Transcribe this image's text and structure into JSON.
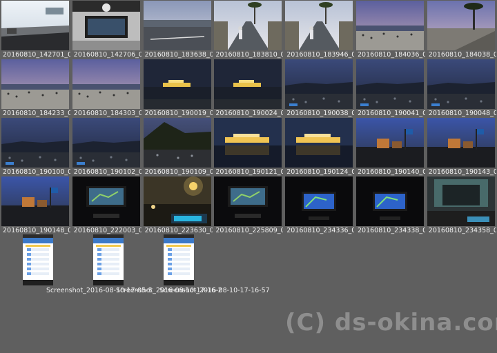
{
  "thumbnails": [
    {
      "label": "20160810_142701_0",
      "scene": "car-dash-day"
    },
    {
      "label": "20160810_142706_0",
      "scene": "car-console"
    },
    {
      "label": "20160810_183638_0",
      "scene": "road-dusk"
    },
    {
      "label": "20160810_183810_0",
      "scene": "street-palms"
    },
    {
      "label": "20160810_183946_0",
      "scene": "street-palms"
    },
    {
      "label": "20160810_184036_0",
      "scene": "beach-crowd-dusk"
    },
    {
      "label": "20160810_184038_0",
      "scene": "beach-palms-dusk"
    },
    {
      "label": "20160810_184233_0",
      "scene": "beach-crowd-dusk"
    },
    {
      "label": "20160810_184303_0",
      "scene": "beach-crowd-dusk"
    },
    {
      "label": "20160810_190019_0",
      "scene": "ship-night"
    },
    {
      "label": "20160810_190024_0",
      "scene": "ship-night"
    },
    {
      "label": "20160810_190038_0",
      "scene": "beach-night"
    },
    {
      "label": "20160810_190041_0",
      "scene": "beach-night"
    },
    {
      "label": "20160810_190048_0",
      "scene": "beach-night"
    },
    {
      "label": "20160810_190100_0",
      "scene": "beach-night"
    },
    {
      "label": "20160810_190102_0",
      "scene": "beach-night"
    },
    {
      "label": "20160810_190109_0",
      "scene": "hill-crowd-night"
    },
    {
      "label": "20160810_190121_0",
      "scene": "ship-night-lit"
    },
    {
      "label": "20160810_190124_0",
      "scene": "ship-night-lit"
    },
    {
      "label": "20160810_190140_0",
      "scene": "town-night-sign"
    },
    {
      "label": "20160810_190143_0",
      "scene": "town-night-sign"
    },
    {
      "label": "20160810_190148_0",
      "scene": "town-night-sign"
    },
    {
      "label": "20160810_222003_0",
      "scene": "car-nav-screen"
    },
    {
      "label": "20160810_223630_0",
      "scene": "road-night-lights"
    },
    {
      "label": "20160810_225809_0",
      "scene": "car-nav-screen"
    },
    {
      "label": "20160810_234336_0",
      "scene": "car-nav-blue"
    },
    {
      "label": "20160810_234338_0",
      "scene": "car-nav-blue"
    },
    {
      "label": "20160810_234358_0",
      "scene": "tunnel-night"
    }
  ],
  "screenshots": [
    {
      "label": "Screenshot_2016-08-10-17-05-5"
    },
    {
      "label": "Screenshot_2016-08-10-17-16-2"
    },
    {
      "label": "Screenshot_2016-08-10-17-16-57"
    }
  ],
  "watermark": "(C) ds-okina.com",
  "colors": {
    "background": "#5f5f5f",
    "label_text": "#f0f0f0",
    "watermark": "#8e8e8e"
  }
}
